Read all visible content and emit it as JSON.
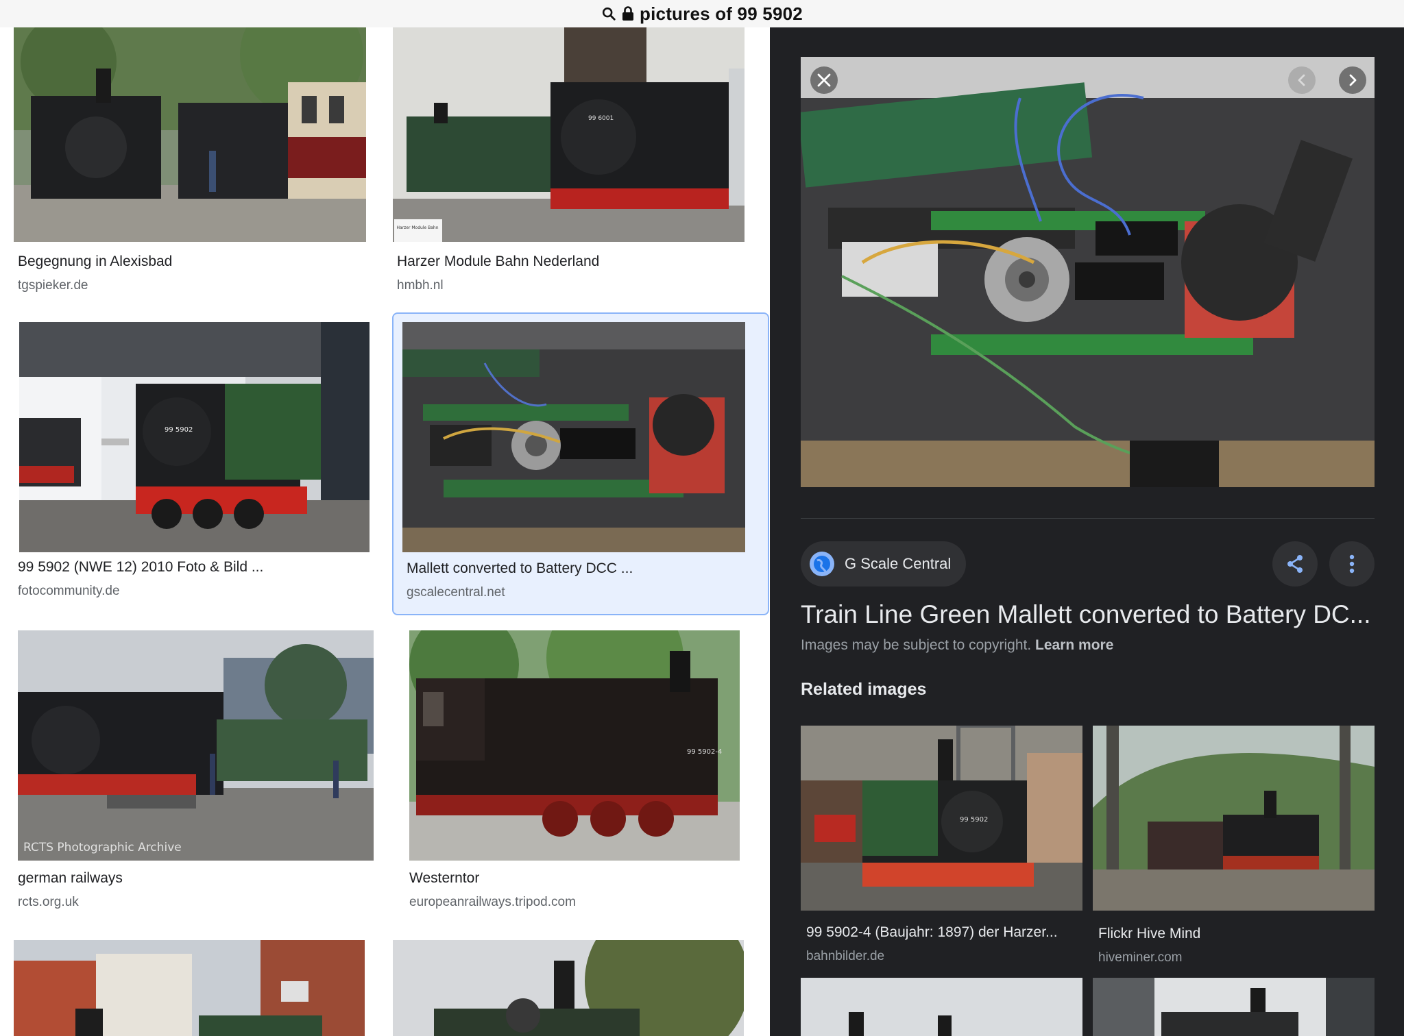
{
  "browser": {
    "url_text": "pictures of 99 5902"
  },
  "results": [
    {
      "caption": "Begegnung in Alexisbad",
      "source": "tgspieker.de"
    },
    {
      "caption": "Harzer Module Bahn Nederland",
      "source": "hmbh.nl"
    },
    {
      "caption": "99 5902 (NWE 12) 2010 Foto & Bild ...",
      "source": "fotocommunity.de"
    },
    {
      "caption": "Mallett converted to Battery DCC ...",
      "source": "gscalecentral.net"
    },
    {
      "caption": "german railways",
      "source": "rcts.org.uk"
    },
    {
      "caption": "Westerntor",
      "source": "europeanrailways.tripod.com"
    }
  ],
  "thumb_text": {
    "loco_number": "99 5902",
    "harzer_sign": "Harzer Module Bahn",
    "rcts_watermark": "RCTS Photographic Archive"
  },
  "panel": {
    "site_name": "G Scale Central",
    "title": "Train Line Green Mallett converted to Battery DC...",
    "copyright_text": "Images may be subject to copyright.",
    "learn_more": "Learn more",
    "related_heading": "Related images",
    "related": [
      {
        "caption": "99 5902-4 (Baujahr: 1897) der Harzer...",
        "source": "bahnbilder.de"
      },
      {
        "caption": "Flickr Hive Mind",
        "source": "hiveminer.com"
      }
    ]
  },
  "icons": [
    "search-icon",
    "lock-icon",
    "close-icon",
    "chevron-left-icon",
    "chevron-right-icon",
    "globe-icon",
    "share-icon",
    "more-vert-icon"
  ],
  "colors": {
    "panel_bg": "#202124",
    "selected_bg": "#e8f0fe",
    "selected_border": "#8ab4f8",
    "accent": "#8ab4f8"
  }
}
